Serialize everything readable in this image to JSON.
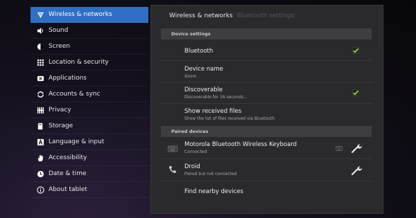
{
  "sidebar": {
    "items": [
      {
        "label": "Wireless & networks",
        "icon": "wifi-icon",
        "selected": true
      },
      {
        "label": "Sound",
        "icon": "speaker-icon",
        "selected": false
      },
      {
        "label": "Screen",
        "icon": "brightness-icon",
        "selected": false
      },
      {
        "label": "Location & security",
        "icon": "grid-lock-icon",
        "selected": false
      },
      {
        "label": "Applications",
        "icon": "apps-icon",
        "selected": false
      },
      {
        "label": "Accounts & sync",
        "icon": "sync-icon",
        "selected": false
      },
      {
        "label": "Privacy",
        "icon": "privacy-icon",
        "selected": false
      },
      {
        "label": "Storage",
        "icon": "storage-icon",
        "selected": false
      },
      {
        "label": "Language & input",
        "icon": "language-icon",
        "selected": false
      },
      {
        "label": "Accessibility",
        "icon": "hand-icon",
        "selected": false
      },
      {
        "label": "Date & time",
        "icon": "clock-icon",
        "selected": false
      },
      {
        "label": "About tablet",
        "icon": "info-icon",
        "selected": false
      }
    ]
  },
  "breadcrumb": {
    "parent": "Wireless & networks",
    "current": "Bluetooth settings"
  },
  "device_settings": {
    "header": "Device settings",
    "bluetooth": {
      "title": "Bluetooth",
      "checked": true
    },
    "device_name": {
      "title": "Device name",
      "summary": "Xoom"
    },
    "discoverable": {
      "title": "Discoverable",
      "summary": "Discoverable for 16 seconds...",
      "checked": true
    },
    "show_received": {
      "title": "Show received files",
      "summary": "Show the list of files received via Bluetooth"
    }
  },
  "paired_devices": {
    "header": "Paired devices",
    "devices": [
      {
        "title": "Motorola Bluetooth Wireless Keyboard",
        "summary": "Connected",
        "icon": "keyboard-icon"
      },
      {
        "title": "Droid",
        "summary": "Paired but not connected",
        "icon": "phone-icon"
      }
    ],
    "find_nearby": "Find nearby devices"
  },
  "colors": {
    "selected_bg": "#2f6fc4",
    "check_green": "#9ad13b",
    "panel_bg": "#2a2a2c",
    "section_bg": "#3e3e41"
  }
}
